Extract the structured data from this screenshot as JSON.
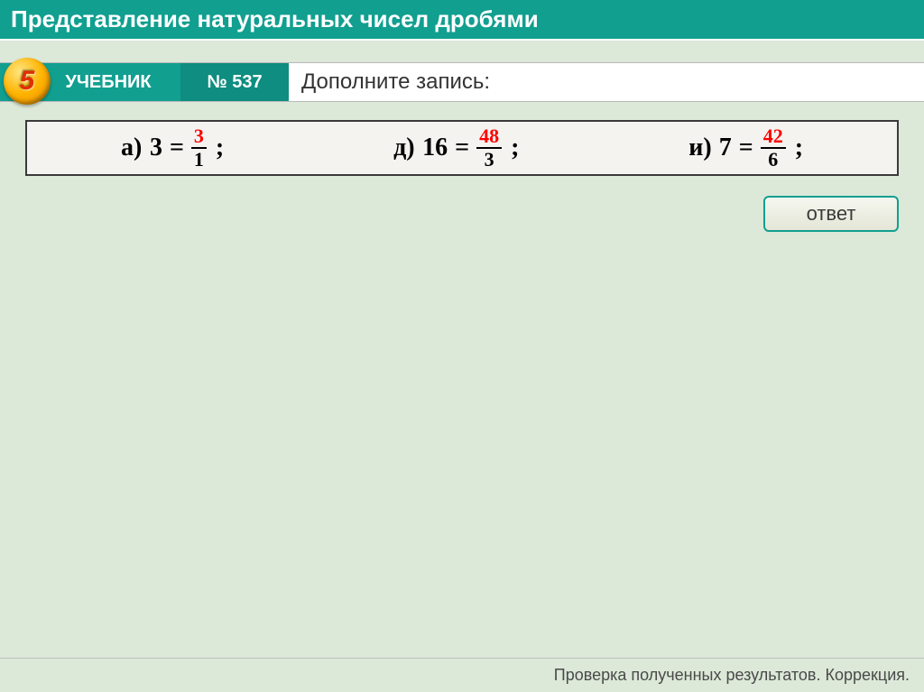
{
  "title": "Представление натуральных чисел дробями",
  "badge": "5",
  "header": {
    "tab_uchebnik": "УЧЕБНИК",
    "tab_number": "№ 537",
    "prompt": "Дополните запись:"
  },
  "equations": {
    "a": {
      "label": "а)",
      "whole": "3",
      "eq": "=",
      "num": "3",
      "den": "1"
    },
    "d": {
      "label": "д)",
      "whole": "16",
      "eq": "=",
      "num": "48",
      "den": "3"
    },
    "i": {
      "label": "и)",
      "whole": "7",
      "eq": "=",
      "num": "42",
      "den": "6"
    }
  },
  "semicolon": ";",
  "answer_button": "ответ",
  "footer": "Проверка полученных результатов. Коррекция."
}
